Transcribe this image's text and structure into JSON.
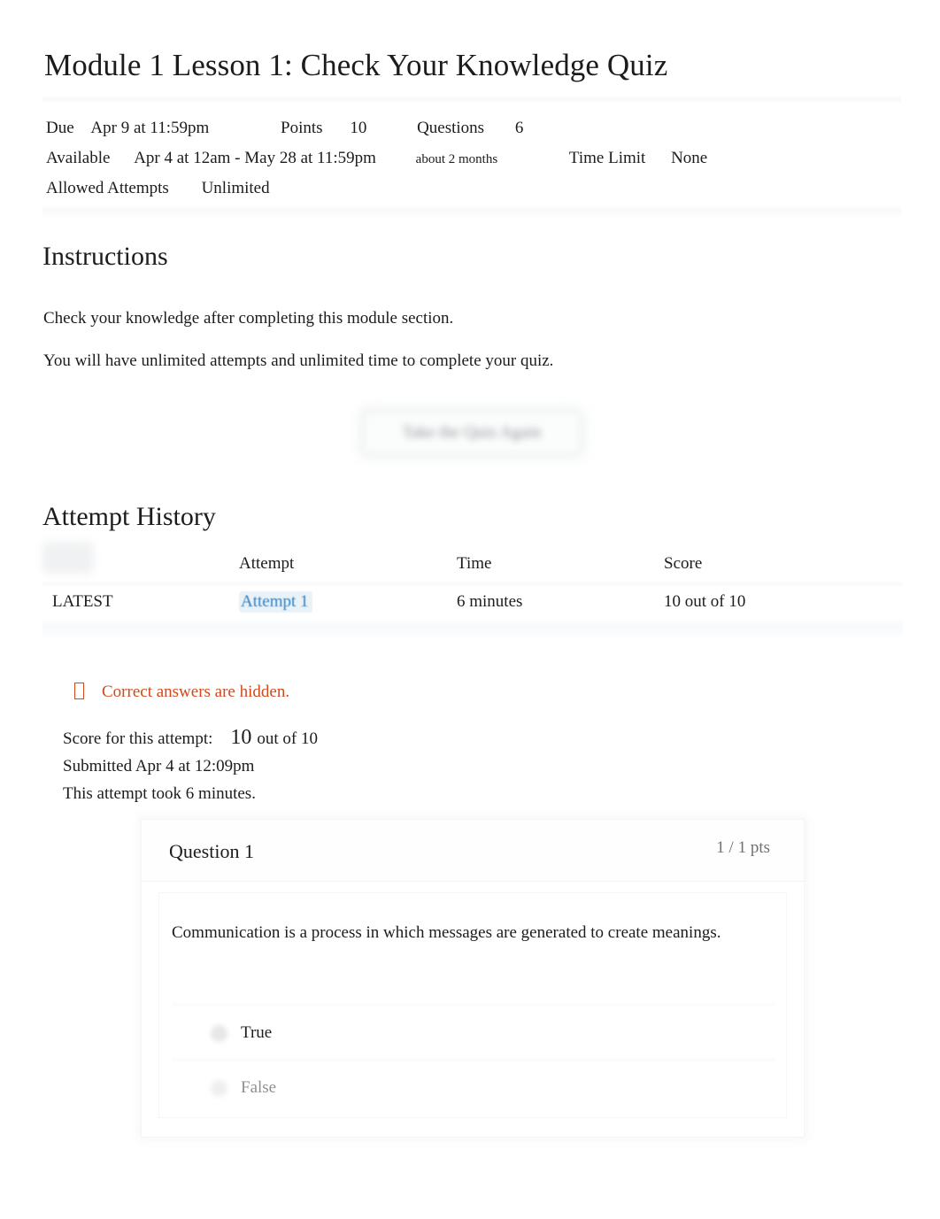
{
  "quiz": {
    "title": "Module 1 Lesson 1: Check Your Knowledge Quiz"
  },
  "meta": {
    "due_label": "Due",
    "due_value": "Apr 9 at 11:59pm",
    "points_label": "Points",
    "points_value": "10",
    "questions_label": "Questions",
    "questions_value": "6",
    "available_label": "Available",
    "available_value": "Apr 4 at 12am - May 28 at 11:59pm",
    "available_duration": "about 2 months",
    "time_limit_label": "Time Limit",
    "time_limit_value": "None",
    "allowed_attempts_label": "Allowed Attempts",
    "allowed_attempts_value": "Unlimited"
  },
  "instructions": {
    "heading": "Instructions",
    "paragraph_1": "Check your knowledge after completing this module section.",
    "paragraph_2": "You will have unlimited attempts and unlimited time to complete your quiz."
  },
  "actions": {
    "take_quiz_again": "Take the Quiz Again"
  },
  "attempt_history": {
    "heading": "Attempt History",
    "columns": {
      "kept": "",
      "attempt": "Attempt",
      "time": "Time",
      "score": "Score"
    },
    "rows": [
      {
        "kept": "LATEST",
        "attempt": "Attempt 1",
        "time": "6 minutes",
        "score": "10 out of 10"
      }
    ]
  },
  "result": {
    "hidden_notice": "Correct answers are hidden.",
    "hidden_notice_icon": "warning-icon",
    "score_label": "Score for this attempt:",
    "score_value": "10",
    "score_suffix": "out of 10",
    "submitted": "Submitted Apr 4 at 12:09pm",
    "duration": "This attempt took 6 minutes."
  },
  "questions": [
    {
      "name": "Question 1",
      "points": "1 / 1 pts",
      "text": "Communication is a process in which messages are generated to create meanings.",
      "answers": [
        {
          "label": "True",
          "selected": true
        },
        {
          "label": "False",
          "selected": false
        }
      ]
    }
  ],
  "colors": {
    "link_blue": "#2d7fc1",
    "warning_orange": "#d2491c",
    "text": "#1c1c1c",
    "muted": "#6d7275"
  }
}
